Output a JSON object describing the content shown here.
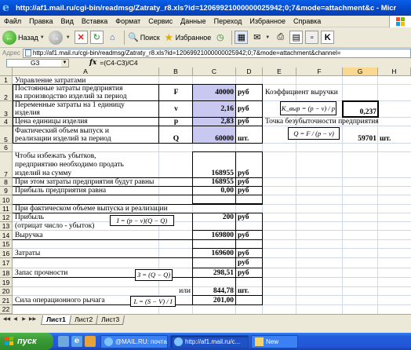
{
  "window": {
    "title": "http://af1.mail.ru/cgi-bin/readmsg/Zatraty_r8.xls?id=12069921000000025942;0;7&mode=attachment&c - Micr"
  },
  "menu": [
    "Файл",
    "Правка",
    "Вид",
    "Вставка",
    "Формат",
    "Сервис",
    "Данные",
    "Переход",
    "Избранное",
    "Справка"
  ],
  "toolbar": {
    "back_label": "Назад",
    "search_label": "Поиск",
    "favorites_label": "Избранное"
  },
  "address": {
    "label": "Адрес",
    "url": "http://af1.mail.ru/cgi-bin/readmsg/Zatraty_r8.xls?id=12069921000000025942;0;7&mode=attachment&channel="
  },
  "formula_bar": {
    "cell_ref": "G3",
    "fx": "fx",
    "formula": "=(C4-C3)/C4"
  },
  "columns": [
    "A",
    "B",
    "C",
    "D",
    "E",
    "F",
    "G",
    "H"
  ],
  "selected_column": "G",
  "rows": [
    "1",
    "2",
    "3",
    "4",
    "5",
    "6",
    "7",
    "8",
    "9",
    "10",
    "11",
    "12",
    "13",
    "14",
    "15",
    "16",
    "17",
    "18",
    "19",
    "20",
    "21",
    "22"
  ],
  "cells": {
    "a1": "Управление затратами",
    "a2_1": "Постоянные затраты предприятия",
    "a2_2": "на производство изделий за период",
    "b2": "F",
    "c2": "40000",
    "d2": "руб",
    "e2": "Коэффициент выручки",
    "a3_1": "Переменные затраты на 1 единицу",
    "a3_2": "изделия",
    "b3": "v",
    "c3": "2,16",
    "d3": "руб",
    "g3": "0,237",
    "a4": "Цена единицы изделия",
    "b4": "p",
    "c4": "2,83",
    "d4": "руб",
    "e4": "Точка безубыточности предприятия",
    "a5_1": "Фактический объем выпуск и",
    "a5_2": "реализации изделий за период",
    "b5": "Q",
    "c5": "60000",
    "d5": "шт.",
    "g5": "59701",
    "h5": "шт.",
    "a7_1": "Чтобы избежать убытков,",
    "a7_2": "предприятию  необходимо продать",
    "a7_3": "изделий на сумму",
    "c7": "168955",
    "d7": "руб",
    "a8": "При этом затраты предприятия будут равны",
    "c8": "168955",
    "d8": "руб",
    "a9": "Прибыль предприятия равна",
    "c9": "0,00",
    "d9": "руб",
    "a11": "При фактическом объеме выпуска и реализации",
    "a12": "Прибыль",
    "c12": "200",
    "d12": "руб",
    "a13": "(отрицат число - убыток)",
    "a14": "Выручка",
    "c14": "169800",
    "d14": "руб",
    "a16": "Затраты",
    "c16": "169600",
    "d16": "руб",
    "d17": "руб",
    "a18": "Запас прочности",
    "c18": "298,51",
    "d18": "руб",
    "b20": "или",
    "c20": "844,78",
    "d20": "шт.",
    "a21": "Сила операционного рычага",
    "c21": "201,00"
  },
  "formulas": {
    "k_vyr": "K_выр = (p − v) / p",
    "q_bez": "Q = F / (p − v)",
    "profit": "I = (p − v)(Q − Q)",
    "zapas": "З = (Q − Q)",
    "lever": "L = (S − V) / I"
  },
  "sheet_tabs": [
    "Лист1",
    "Лист2",
    "Лист3"
  ],
  "active_tab": "Лист1",
  "taskbar": {
    "start_label": "пуск",
    "tasks": [
      "@MAIL.RU: почта,...",
      "http://af1.mail.ru/c...",
      "New"
    ]
  },
  "colors": {
    "input_fill": "#c8c8f0",
    "selected_col": "#f9d98f",
    "title_blue": "#0348c8"
  }
}
